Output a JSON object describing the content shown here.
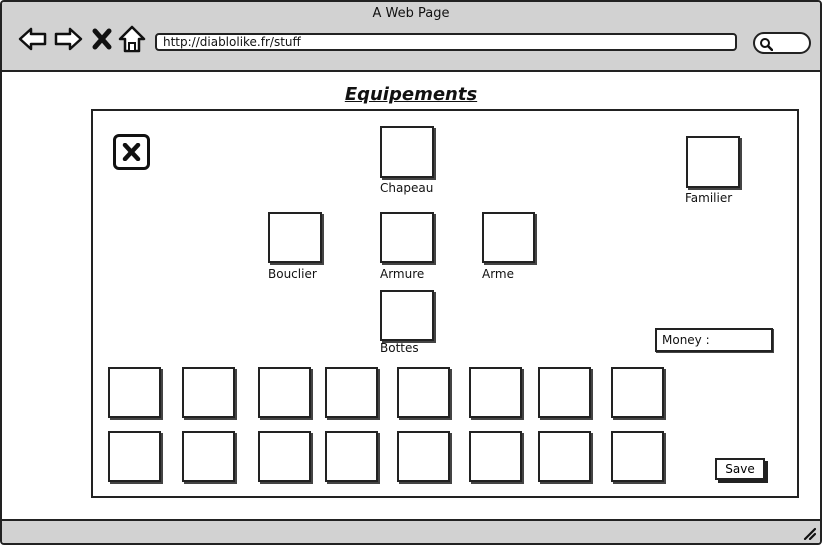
{
  "window": {
    "title": "A Web Page"
  },
  "toolbar": {
    "back_icon": "back-arrow-icon",
    "forward_icon": "forward-arrow-icon",
    "stop_icon": "close-x-icon",
    "home_icon": "home-icon",
    "url": "http://diablolike.fr/stuff",
    "search_icon": "search-icon"
  },
  "page": {
    "heading": "Equipements"
  },
  "equipment": {
    "close_icon": "close-x-icon",
    "slots": {
      "chapeau": "Chapeau",
      "familier": "Familier",
      "bouclier": "Bouclier",
      "armure": "Armure",
      "arme": "Arme",
      "bottes": "Bottes"
    }
  },
  "money": {
    "label": "Money :"
  },
  "inventory": {
    "rows": 2,
    "columns": 8
  },
  "actions": {
    "save_label": "Save"
  }
}
